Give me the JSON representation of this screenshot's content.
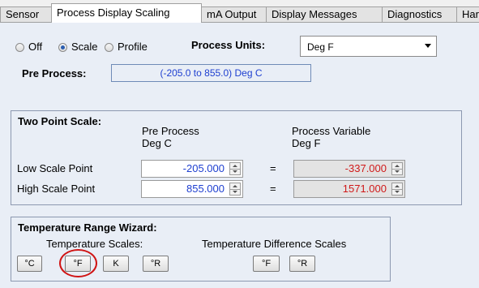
{
  "tabs": [
    {
      "label": "Sensor"
    },
    {
      "label": "Process Display Scaling"
    },
    {
      "label": "mA Output"
    },
    {
      "label": "Display Messages"
    },
    {
      "label": "Diagnostics"
    },
    {
      "label": "Har"
    }
  ],
  "mode": {
    "off_label": "Off",
    "scale_label": "Scale",
    "profile_label": "Profile",
    "selected": "Scale"
  },
  "process_units": {
    "label": "Process Units:",
    "value": "Deg F"
  },
  "pre_process": {
    "label": "Pre Process:",
    "range_text": "(-205.0 to 855.0) Deg C"
  },
  "two_point_scale": {
    "title": "Two Point Scale:",
    "col1_header": "Pre Process",
    "col1_unit": "Deg C",
    "col2_header": "Process Variable",
    "col2_unit": "Deg F",
    "rows": [
      {
        "label": "Low Scale Point",
        "pre": "-205.000",
        "equals": "=",
        "pv": "-337.000"
      },
      {
        "label": "High Scale Point",
        "pre": "855.000",
        "equals": "=",
        "pv": "1571.000"
      }
    ]
  },
  "wizard": {
    "title": "Temperature Range Wizard:",
    "scales_label": "Temperature Scales:",
    "diff_label": "Temperature Difference Scales",
    "scale_buttons": [
      "°C",
      "°F",
      "K",
      "°R"
    ],
    "diff_buttons": [
      "°F",
      "°R"
    ],
    "highlighted": "°F"
  },
  "colors": {
    "value_blue": "#1e3fd0",
    "value_red": "#d01a1a",
    "highlight_circle": "#d01414",
    "panel_bg": "#e9eef6"
  }
}
